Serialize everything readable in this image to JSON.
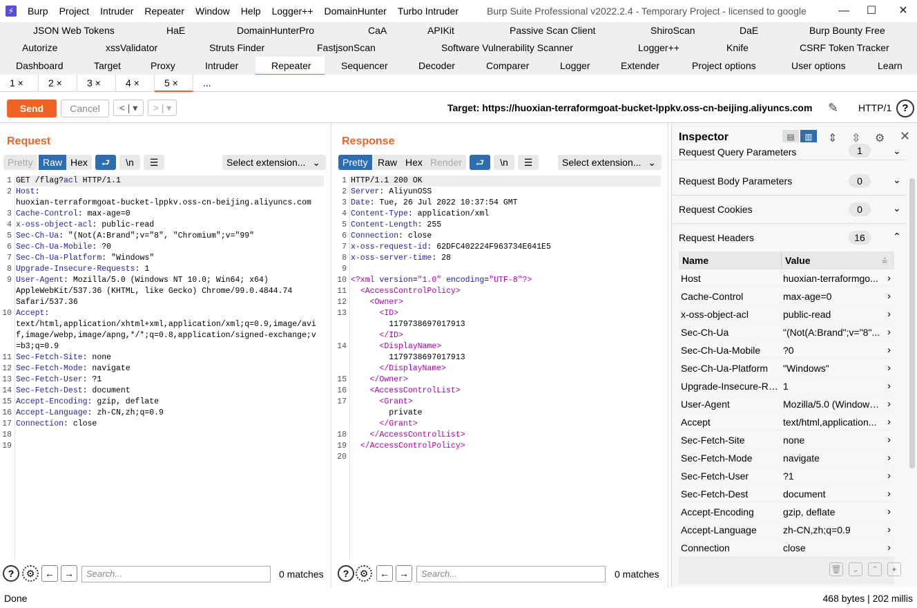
{
  "menubar": {
    "items": [
      "Burp",
      "Project",
      "Intruder",
      "Repeater",
      "Window",
      "Help",
      "Logger++",
      "DomainHunter",
      "Turbo Intruder"
    ],
    "window_title": "Burp Suite Professional v2022.2.4 - Temporary Project - licensed to google"
  },
  "extension_tabs_row1": [
    "JSON Web Tokens",
    "HaE",
    "DomainHunterPro",
    "CaA",
    "APIKit",
    "Passive Scan Client",
    "ShiroScan",
    "DaE",
    "Burp Bounty Free"
  ],
  "extension_tabs_row2": [
    "Autorize",
    "xssValidator",
    "Struts Finder",
    "FastjsonScan",
    "Software Vulnerability Scanner",
    "Logger++",
    "Knife",
    "CSRF Token Tracker"
  ],
  "main_tabs": [
    "Dashboard",
    "Target",
    "Proxy",
    "Intruder",
    "Repeater",
    "Sequencer",
    "Decoder",
    "Comparer",
    "Logger",
    "Extender",
    "Project options",
    "User options",
    "Learn"
  ],
  "repeater_tabs": [
    "1 ×",
    "2 ×",
    "3 ×",
    "4 ×",
    "5 ×",
    "..."
  ],
  "toolbar": {
    "send_label": "Send",
    "cancel_label": "Cancel",
    "target_text": "Target: https://huoxian-terraformgoat-bucket-lppkv.oss-cn-beijing.aliyuncs.com",
    "http_version": "HTTP/1"
  },
  "request": {
    "title": "Request",
    "views": [
      "Pretty",
      "Raw",
      "Hex"
    ],
    "selected_view": "Raw",
    "ext_select": "Select extension...",
    "newline_btn": "\\n",
    "search_placeholder": "Search...",
    "matches": "0 matches"
  },
  "response": {
    "title": "Response",
    "views": [
      "Pretty",
      "Raw",
      "Hex",
      "Render"
    ],
    "selected_view": "Pretty",
    "ext_select": "Select extension...",
    "newline_btn": "\\n",
    "search_placeholder": "Search...",
    "matches": "0 matches"
  },
  "inspector": {
    "title": "Inspector",
    "sections": [
      {
        "label": "Request Query Parameters",
        "count": "1"
      },
      {
        "label": "Request Body Parameters",
        "count": "0"
      },
      {
        "label": "Request Cookies",
        "count": "0"
      },
      {
        "label": "Request Headers",
        "count": "16"
      }
    ],
    "table_headers": [
      "Name",
      "Value"
    ],
    "headers": [
      {
        "name": "Host",
        "value": "huoxian-terraformgo..."
      },
      {
        "name": "Cache-Control",
        "value": "max-age=0"
      },
      {
        "name": "x-oss-object-acl",
        "value": "public-read"
      },
      {
        "name": "Sec-Ch-Ua",
        "value": "\"(Not(A:Brand\";v=\"8\"..."
      },
      {
        "name": "Sec-Ch-Ua-Mobile",
        "value": "?0"
      },
      {
        "name": "Sec-Ch-Ua-Platform",
        "value": "\"Windows\""
      },
      {
        "name": "Upgrade-Insecure-Re...",
        "value": "1"
      },
      {
        "name": "User-Agent",
        "value": "Mozilla/5.0 (Windows..."
      },
      {
        "name": "Accept",
        "value": "text/html,application..."
      },
      {
        "name": "Sec-Fetch-Site",
        "value": "none"
      },
      {
        "name": "Sec-Fetch-Mode",
        "value": "navigate"
      },
      {
        "name": "Sec-Fetch-User",
        "value": "?1"
      },
      {
        "name": "Sec-Fetch-Dest",
        "value": "document"
      },
      {
        "name": "Accept-Encoding",
        "value": "gzip, deflate"
      },
      {
        "name": "Accept-Language",
        "value": "zh-CN,zh;q=0.9"
      },
      {
        "name": "Connection",
        "value": "close"
      }
    ]
  },
  "status": {
    "left": "Done",
    "right": "468 bytes | 202 millis"
  },
  "colors": {
    "accent": "#f06423",
    "selected": "#2e6db0"
  }
}
